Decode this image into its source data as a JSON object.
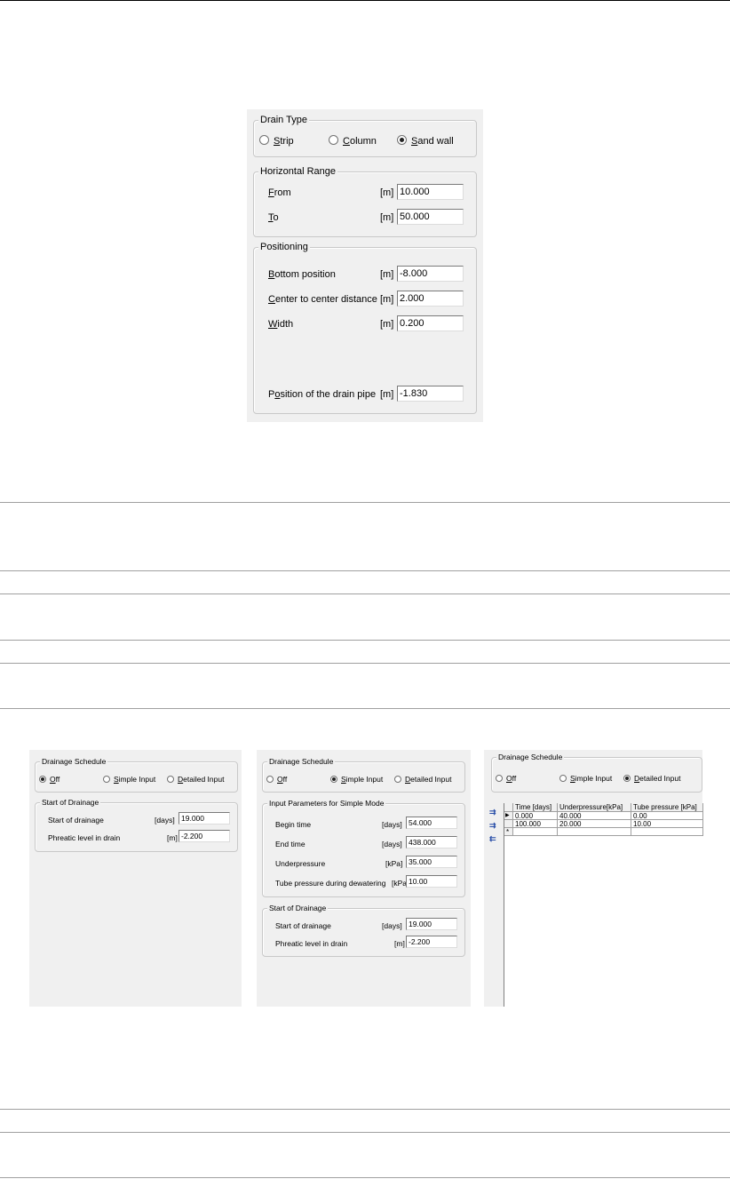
{
  "dialog1": {
    "drain_type": {
      "legend": "Drain Type",
      "options": [
        {
          "prefix": "",
          "ul": "S",
          "rest": "trip",
          "checked": false
        },
        {
          "prefix": "",
          "ul": "C",
          "rest": "olumn",
          "checked": false
        },
        {
          "prefix": "",
          "ul": "S",
          "rest": "and wall",
          "checked": true
        }
      ]
    },
    "horizontal_range": {
      "legend": "Horizontal Range",
      "from": {
        "ul": "F",
        "rest": "rom",
        "unit": "[m]",
        "value": "10.000"
      },
      "to": {
        "ul": "T",
        "rest": "o",
        "unit": "[m]",
        "value": "50.000"
      }
    },
    "positioning": {
      "legend": "Positioning",
      "bottom": {
        "ul": "B",
        "rest": "ottom position",
        "unit": "[m]",
        "value": "-8.000"
      },
      "center": {
        "ul": "C",
        "rest": "enter to center distance",
        "unit": "[m]",
        "value": "2.000"
      },
      "width": {
        "ul": "W",
        "rest": "idth",
        "unit": "[m]",
        "value": "0.200"
      },
      "pipe": {
        "pre": "P",
        "ul": "o",
        "rest": "sition of the drain pipe",
        "unit": "[m]",
        "value": "-1.830"
      }
    }
  },
  "dialog2": {
    "schedule": {
      "legend": "Drainage Schedule",
      "off": {
        "ul": "O",
        "rest": "ff",
        "checked": true
      },
      "simple": {
        "ul": "S",
        "rest": "imple Input",
        "checked": false
      },
      "detailed": {
        "ul": "D",
        "rest": "etailed Input",
        "checked": false
      }
    },
    "start": {
      "legend": "Start of Drainage",
      "start_label": "Start of drainage",
      "start_unit": "[days]",
      "start_value": "19.000",
      "phreatic_label": "Phreatic level in drain",
      "phreatic_unit": "[m]",
      "phreatic_value": "-2.200"
    }
  },
  "dialog3": {
    "schedule": {
      "legend": "Drainage Schedule",
      "off": {
        "ul": "O",
        "rest": "ff",
        "checked": false
      },
      "simple": {
        "ul": "S",
        "rest": "imple Input",
        "checked": true
      },
      "detailed": {
        "ul": "D",
        "rest": "etailed Input",
        "checked": false
      }
    },
    "simple_params": {
      "legend": "Input Parameters for Simple Mode",
      "begin_label": "Begin time",
      "begin_unit": "[days]",
      "begin_value": "54.000",
      "end_label": "End time",
      "end_unit": "[days]",
      "end_value": "438.000",
      "under_label": "Underpressure",
      "under_unit": "[kPa]",
      "under_value": "35.000",
      "tube_label": "Tube pressure during dewatering",
      "tube_unit": "[kPa]",
      "tube_value": "10.00"
    },
    "start": {
      "legend": "Start of Drainage",
      "start_label": "Start of drainage",
      "start_unit": "[days]",
      "start_value": "19.000",
      "phreatic_label": "Phreatic level in drain",
      "phreatic_unit": "[m]",
      "phreatic_value": "-2.200"
    }
  },
  "dialog4": {
    "schedule": {
      "legend": "Drainage Schedule",
      "off": {
        "ul": "O",
        "rest": "ff",
        "checked": false
      },
      "simple": {
        "ul": "S",
        "rest": "imple Input",
        "checked": false
      },
      "detailed": {
        "ul": "D",
        "rest": "etailed Input",
        "checked": true
      }
    },
    "table": {
      "headers": [
        "Time [days]",
        "Underpressure[kPa]",
        "Tube pressure [kPa]"
      ],
      "rows": [
        [
          "0.000",
          "40.000",
          "0.00"
        ],
        [
          "100.000",
          "20.000",
          "10.00"
        ]
      ],
      "current_marker": "▶",
      "new_marker": "*"
    },
    "toolbar_icons": [
      "insert-row-icon",
      "add-row-icon",
      "delete-row-icon"
    ]
  }
}
